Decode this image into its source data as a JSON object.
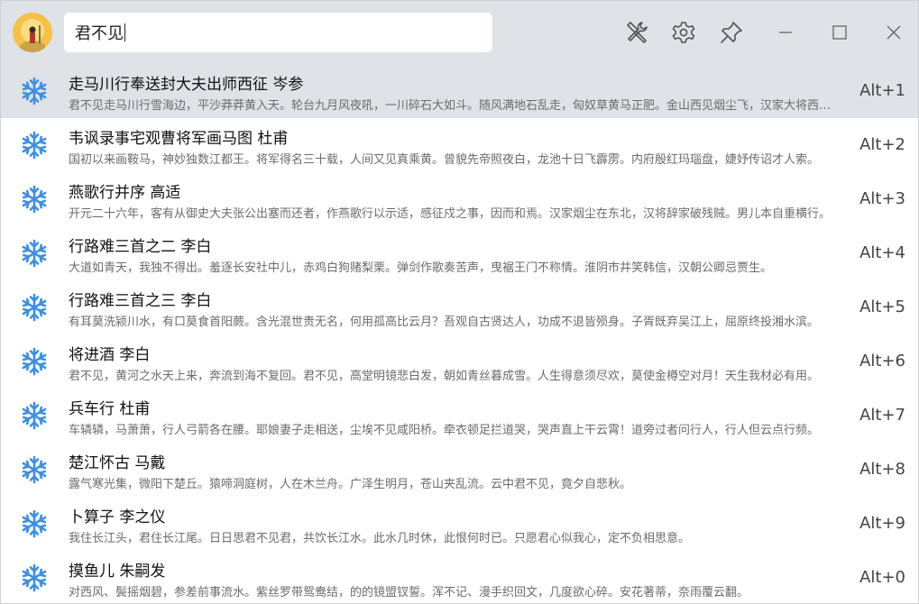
{
  "search": {
    "value": "君不见"
  },
  "header": {
    "tools_icon": "tools-icon",
    "settings_icon": "gear-icon",
    "pin_icon": "pin-icon",
    "minimize_icon": "minimize-icon",
    "maximize_icon": "maximize-icon",
    "close_icon": "close-icon"
  },
  "results": [
    {
      "title": "走马川行奉送封大夫出师西征 岑参",
      "excerpt": "君不见走马川行雪海边，平沙莽莽黄入天。轮台九月风夜吼，一川碎石大如斗。随风满地石乱走，匈奴草黄马正肥。金山西见烟尘飞，汉家大将西出师。",
      "shortcut": "Alt+1"
    },
    {
      "title": "韦讽录事宅观曹将军画马图 杜甫",
      "excerpt": "国初以来画鞍马，神妙独数江都王。将军得名三十载，人间又见真乘黄。曾貌先帝照夜白，龙池十日飞霹雳。内府殷红玛瑙盘，婕妤传诏才人索。",
      "shortcut": "Alt+2"
    },
    {
      "title": "燕歌行并序 高适",
      "excerpt": "开元二十六年，客有从御史大夫张公出塞而还者，作燕歌行以示适，感征戍之事，因而和焉。汉家烟尘在东北，汉将辞家破残贼。男儿本自重横行。",
      "shortcut": "Alt+3"
    },
    {
      "title": "行路难三首之二 李白",
      "excerpt": "大道如青天，我独不得出。羞逐长安社中儿，赤鸡白狗赌梨栗。弹剑作歌奏苦声，曳裾王门不称情。淮阴市井笑韩信，汉朝公卿忌贾生。",
      "shortcut": "Alt+4"
    },
    {
      "title": "行路难三首之三 李白",
      "excerpt": "有耳莫洗颍川水，有口莫食首阳蕨。含光混世贵无名，何用孤高比云月？吾观自古贤达人，功成不退皆殒身。子胥既弃吴江上，屈原终投湘水滨。",
      "shortcut": "Alt+5"
    },
    {
      "title": "将进酒 李白",
      "excerpt": "君不见，黄河之水天上来，奔流到海不复回。君不见，高堂明镜悲白发，朝如青丝暮成雪。人生得意须尽欢，莫使金樽空对月！天生我材必有用。",
      "shortcut": "Alt+6"
    },
    {
      "title": "兵车行 杜甫",
      "excerpt": "车辚辚，马萧萧，行人弓箭各在腰。耶娘妻子走相送，尘埃不见咸阳桥。牵衣顿足拦道哭，哭声直上干云霄！道旁过者问行人，行人但云点行频。",
      "shortcut": "Alt+7"
    },
    {
      "title": "楚江怀古 马戴",
      "excerpt": "露气寒光集，微阳下楚丘。猿啼洞庭树，人在木兰舟。广泽生明月，苍山夹乱流。云中君不见，竟夕自悲秋。",
      "shortcut": "Alt+8"
    },
    {
      "title": "卜算子 李之仪",
      "excerpt": "我住长江头，君住长江尾。日日思君不见君，共饮长江水。此水几时休，此恨何时已。只愿君心似我心，定不负相思意。",
      "shortcut": "Alt+9"
    },
    {
      "title": "摸鱼儿 朱嗣发",
      "excerpt": "对西风、鬓摇烟碧，参差前事流水。紫丝罗带鸳鸯结，的的镜盟钗誓。浑不记、漫手织回文，几度欲心碎。安花著蒂，奈雨覆云翻。",
      "shortcut": "Alt+0"
    }
  ]
}
